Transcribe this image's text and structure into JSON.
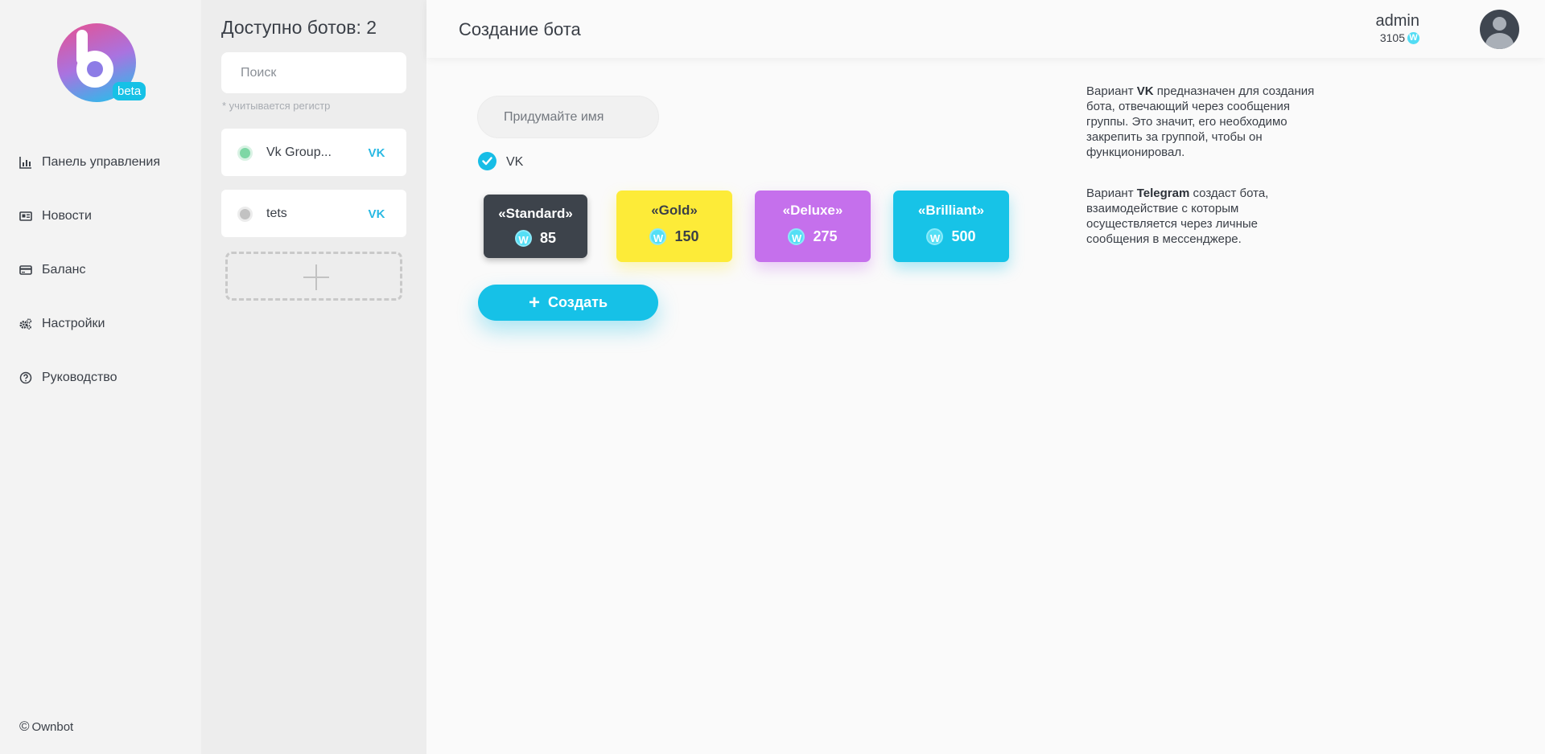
{
  "sidebar": {
    "logo_badge": "beta",
    "items": [
      {
        "label": "Панель управления",
        "icon": "bar-chart-icon"
      },
      {
        "label": "Новости",
        "icon": "newspaper-icon"
      },
      {
        "label": "Баланс",
        "icon": "credit-card-icon"
      },
      {
        "label": "Настройки",
        "icon": "gears-icon"
      },
      {
        "label": "Руководство",
        "icon": "question-circle-icon"
      }
    ],
    "copyright": "Ownbot"
  },
  "bots_panel": {
    "title": "Доступно ботов: 2",
    "search_placeholder": "Поиск",
    "hint": "* учитывается регистр",
    "bots": [
      {
        "name": "Vk Group...",
        "status": "active",
        "platform": "vk-icon"
      },
      {
        "name": "tets",
        "status": "inactive",
        "platform": "vk-icon"
      }
    ]
  },
  "header": {
    "title": "Создание бота",
    "user": {
      "name": "admin",
      "balance": "3105",
      "coin": "W"
    }
  },
  "form": {
    "name_placeholder": "Придумайте имя",
    "platform_label": "VK",
    "platform_checked": true,
    "plans": [
      {
        "name": "«Standard»",
        "price": "85",
        "color": "#3d434b"
      },
      {
        "name": "«Gold»",
        "price": "150",
        "color": "#fdeb38"
      },
      {
        "name": "«Deluxe»",
        "price": "275",
        "color": "#c570ec"
      },
      {
        "name": "«Brilliant»",
        "price": "500",
        "color": "#17c3e7"
      }
    ],
    "coin": "W",
    "create_label": "Создать"
  },
  "info": {
    "vk": {
      "prefix": "Вариант ",
      "name": "VK",
      "text": " предназначен для создания бота, отвечающий через сообщения группы. Это значит, его необходимо закрепить за группой, чтобы он функционировал."
    },
    "telegram": {
      "prefix": "Вариант ",
      "name": "Telegram",
      "text": " создаст бота, взаимодействие с которым осуществляется через личные сообщения в мессенджере."
    }
  },
  "colors": {
    "accent": "#16c1e7",
    "active": "#7ed7a5",
    "inactive": "#c2c2c2"
  }
}
